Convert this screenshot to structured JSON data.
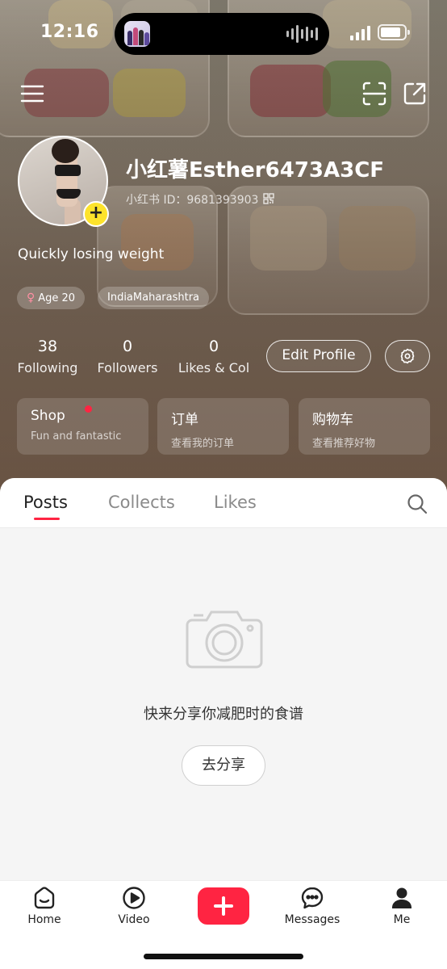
{
  "status_bar": {
    "time": "12:16"
  },
  "profile": {
    "nickname": "小红薯Esther6473A3CF",
    "user_id": "小红书 ID：9681393903",
    "bio": "Quickly losing weight",
    "tags": {
      "age": "Age 20",
      "location": "IndiaMaharashtra"
    },
    "avatar_plus": "+"
  },
  "stats": [
    {
      "value": "38",
      "label": "Following"
    },
    {
      "value": "0",
      "label": "Followers"
    },
    {
      "value": "0",
      "label": "Likes & Col"
    }
  ],
  "actions": {
    "edit_profile": "Edit Profile"
  },
  "cards": [
    {
      "title": "Shop",
      "subtitle": "Fun and fantastic",
      "has_dot": true
    },
    {
      "title": "订单",
      "subtitle": "查看我的订单"
    },
    {
      "title": "购物车",
      "subtitle": "查看推荐好物"
    }
  ],
  "tabs": [
    {
      "label": "Posts",
      "active": true
    },
    {
      "label": "Collects",
      "active": false
    },
    {
      "label": "Likes",
      "active": false
    }
  ],
  "empty_state": {
    "message": "快来分享你减肥时的食谱",
    "button": "去分享"
  },
  "bottom_nav": [
    {
      "label": "Home",
      "icon": "home-icon"
    },
    {
      "label": "Video",
      "icon": "video-icon"
    },
    {
      "label": "",
      "icon": "plus-icon"
    },
    {
      "label": "Messages",
      "icon": "messages-icon"
    },
    {
      "label": "Me",
      "icon": "me-icon"
    }
  ],
  "colors": {
    "accent": "#ff2442",
    "plus_badge": "#fde32b"
  }
}
